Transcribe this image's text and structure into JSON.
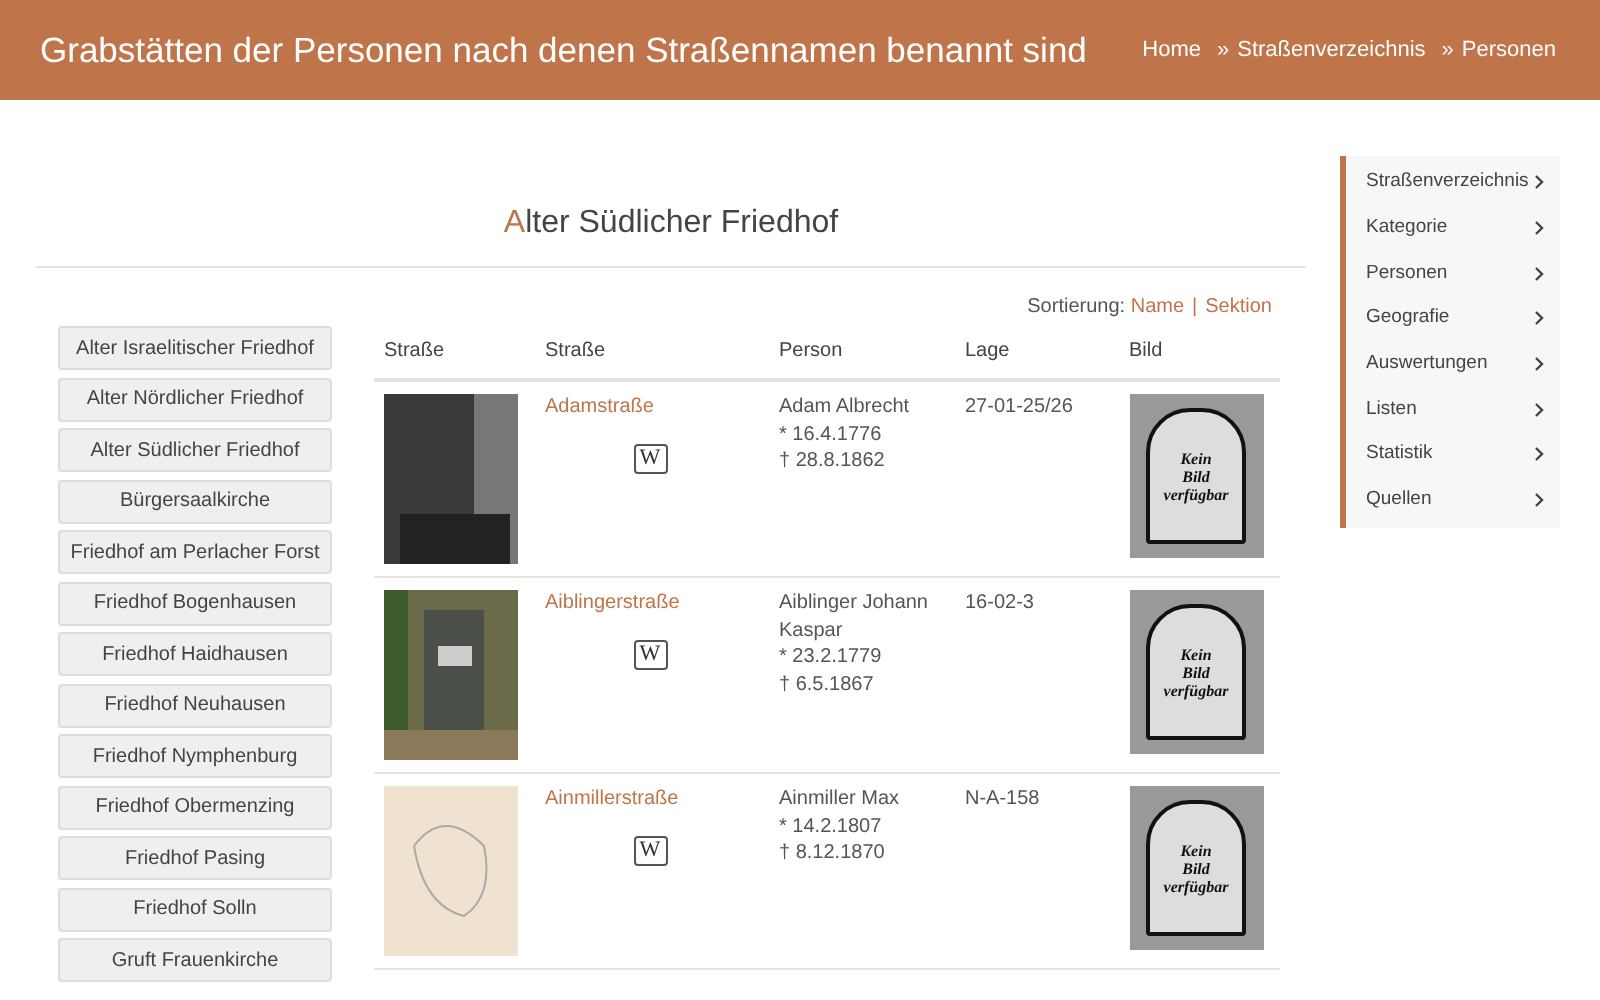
{
  "header": {
    "title": "Grabstätten der Personen nach denen Straßennamen benannt sind",
    "breadcrumb": [
      "Home",
      "Straßenverzeichnis",
      "Personen"
    ],
    "separator": "»"
  },
  "heading": "Alter Südlicher Friedhof",
  "cemeteries": [
    "Alter Israelitischer Friedhof",
    "Alter Nördlicher Friedhof",
    "Alter Südlicher Friedhof",
    "Bürgersaalkirche",
    "Friedhof am Perlacher Forst",
    "Friedhof Bogenhausen",
    "Friedhof Haidhausen",
    "Friedhof Neuhausen",
    "Friedhof Nymphenburg",
    "Friedhof Obermenzing",
    "Friedhof Pasing",
    "Friedhof Solln",
    "Gruft Frauenkirche"
  ],
  "sorting": {
    "label": "Sortierung:",
    "options": [
      "Name",
      "Sektion"
    ],
    "separator": "|"
  },
  "table": {
    "columns": [
      "Straße",
      "Straße",
      "Person",
      "Lage",
      "Bild"
    ],
    "rows": [
      {
        "kind": "portrait",
        "street": "Adamstraße",
        "wiki": "W",
        "person": [
          "Adam Albrecht",
          "* 16.4.1776",
          "† 28.8.1862"
        ],
        "lage": "27-01-25/26",
        "bild": [
          "Kein",
          "Bild",
          "verfügbar"
        ]
      },
      {
        "kind": "grave",
        "street": "Aiblingerstraße",
        "wiki": "W",
        "person": [
          "Aiblinger Johann Kaspar",
          "* 23.2.1779",
          "† 6.5.1867"
        ],
        "lage": "16-02-3",
        "bild": [
          "Kein",
          "Bild",
          "verfügbar"
        ]
      },
      {
        "kind": "sketch",
        "street": "Ainmillerstraße",
        "wiki": "W",
        "person": [
          "Ainmiller Max",
          "* 14.2.1807",
          "† 8.12.1870"
        ],
        "lage": "N-A-158",
        "bild": [
          "Kein",
          "Bild",
          "verfügbar"
        ]
      }
    ]
  },
  "menu": [
    "Straßenverzeichnis",
    "Kategorie",
    "Personen",
    "Geografie",
    "Auswertungen",
    "Listen",
    "Statistik",
    "Quellen"
  ]
}
